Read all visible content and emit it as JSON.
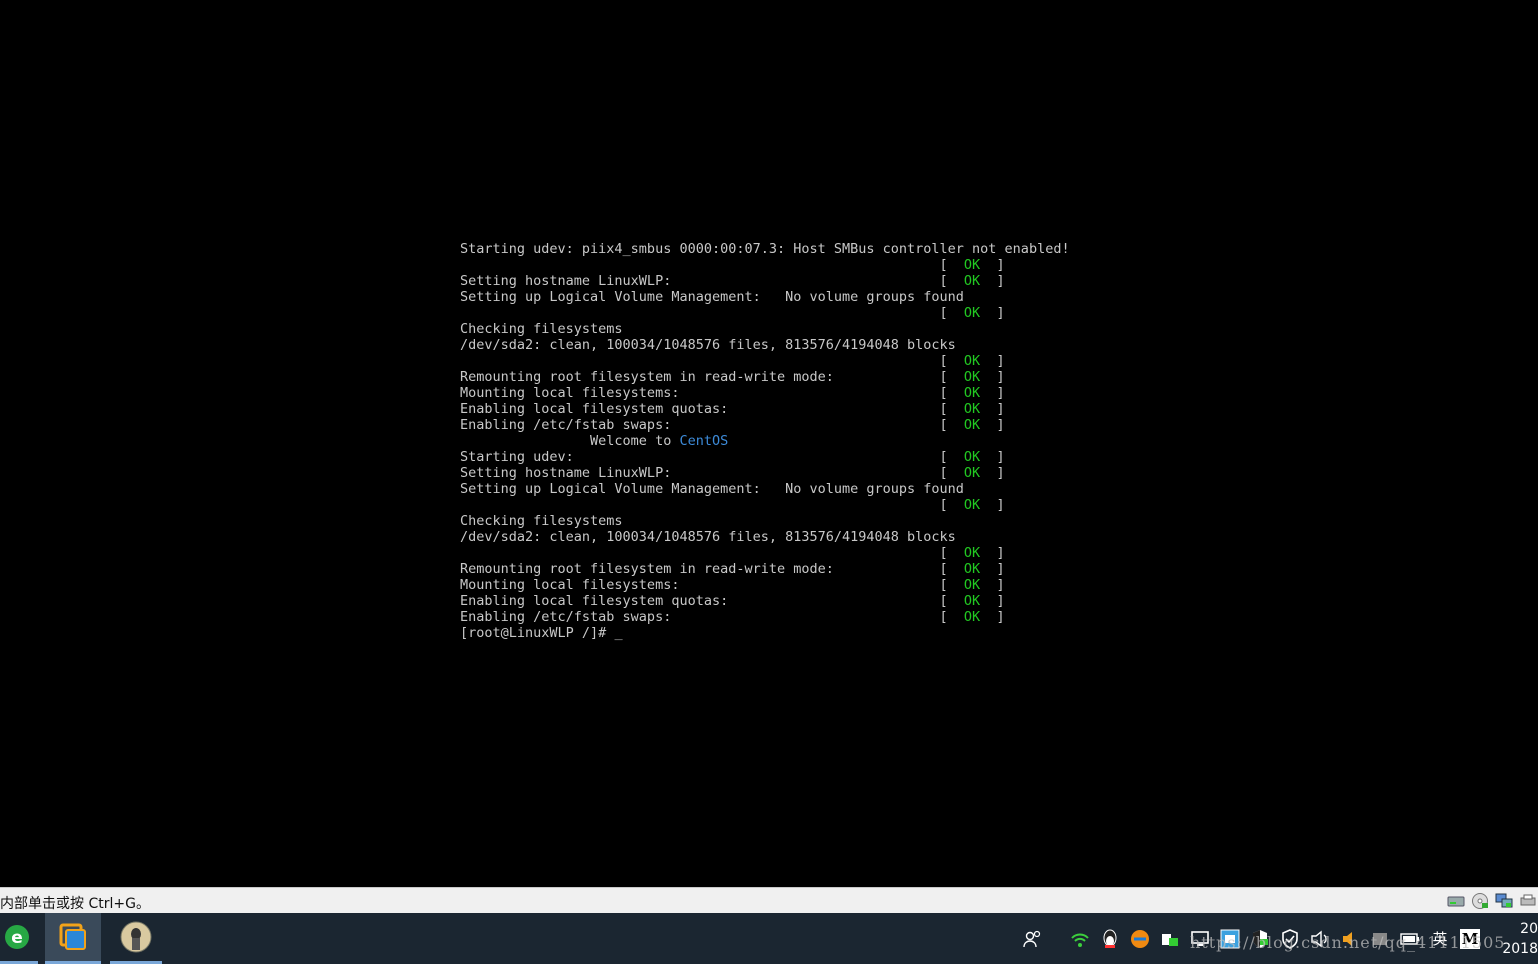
{
  "console": {
    "lines": [
      {
        "t": "Starting udev: piix4_smbus 0000:00:07.3: Host SMBus controller not enabled!",
        "ok": false
      },
      {
        "t": "                                                           [  OK  ]",
        "ok": true
      },
      {
        "t": "Setting hostname LinuxWLP:                                 [  OK  ]",
        "ok": true
      },
      {
        "t": "Setting up Logical Volume Management:   No volume groups found",
        "ok": false
      },
      {
        "t": "                                                           [  OK  ]",
        "ok": true
      },
      {
        "t": "Checking filesystems",
        "ok": false
      },
      {
        "t": "/dev/sda2: clean, 100034/1048576 files, 813576/4194048 blocks",
        "ok": false
      },
      {
        "t": "                                                           [  OK  ]",
        "ok": true
      },
      {
        "t": "Remounting root filesystem in read-write mode:             [  OK  ]",
        "ok": true
      },
      {
        "t": "Mounting local filesystems:                                [  OK  ]",
        "ok": true
      },
      {
        "t": "Enabling local filesystem quotas:                          [  OK  ]",
        "ok": true
      },
      {
        "t": "Enabling /etc/fstab swaps:                                 [  OK  ]",
        "ok": true
      },
      {
        "t": "                Welcome to ",
        "ok": false,
        "centos": "CentOS"
      },
      {
        "t": "Starting udev:                                             [  OK  ]",
        "ok": true
      },
      {
        "t": "Setting hostname LinuxWLP:                                 [  OK  ]",
        "ok": true
      },
      {
        "t": "Setting up Logical Volume Management:   No volume groups found",
        "ok": false
      },
      {
        "t": "                                                           [  OK  ]",
        "ok": true
      },
      {
        "t": "Checking filesystems",
        "ok": false
      },
      {
        "t": "/dev/sda2: clean, 100034/1048576 files, 813576/4194048 blocks",
        "ok": false
      },
      {
        "t": "                                                           [  OK  ]",
        "ok": true
      },
      {
        "t": "Remounting root filesystem in read-write mode:             [  OK  ]",
        "ok": true
      },
      {
        "t": "Mounting local filesystems:                                [  OK  ]",
        "ok": true
      },
      {
        "t": "Enabling local filesystem quotas:                          [  OK  ]",
        "ok": true
      },
      {
        "t": "Enabling /etc/fstab swaps:                                 [  OK  ]",
        "ok": true
      },
      {
        "t": "[root@LinuxWLP /]# ",
        "ok": false,
        "cursor": "_"
      }
    ]
  },
  "statusbar": {
    "hint": "内部单击或按 Ctrl+G。"
  },
  "taskbar": {
    "apps": [
      {
        "name": "ie-browser-icon",
        "active": false
      },
      {
        "name": "vmware-icon",
        "active": true
      },
      {
        "name": "image-viewer-icon",
        "active": false
      }
    ],
    "tray_ime": "英",
    "tray_m": "M",
    "watermark": "https://blog.csdn.net/qq_41111505",
    "clock_time": "20",
    "clock_date": "2018"
  },
  "colors": {
    "ok": "#22c922",
    "centos": "#3d8bd9",
    "console_text": "#c8c8c8",
    "taskbar": "#1b2631"
  }
}
